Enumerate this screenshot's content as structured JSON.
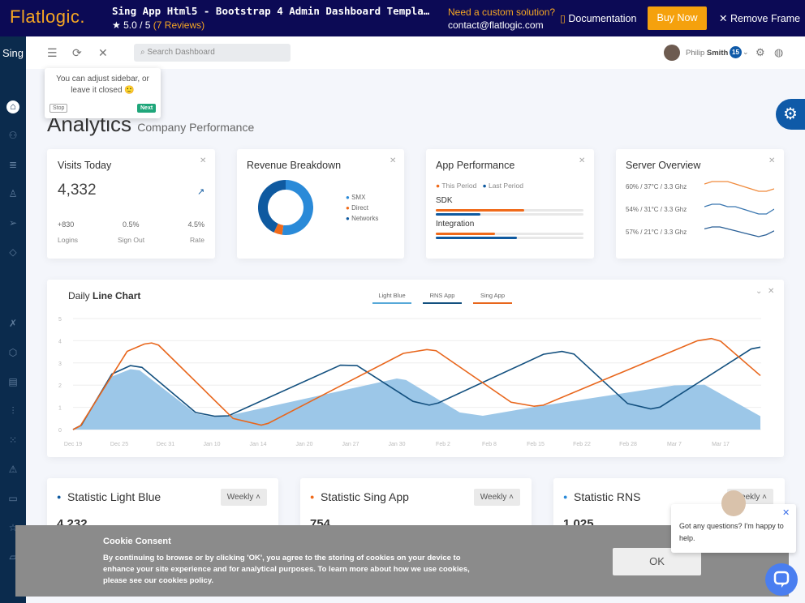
{
  "topbar": {
    "logo": "Flatlogic.",
    "product_title": "Sing App Html5 - Bootstrap 4 Admin Dashboard Templa…",
    "rating": "★ 5.0 / 5",
    "reviews": "(7 Reviews)",
    "need": "Need a custom solution?",
    "contact": "contact@flatlogic.com",
    "documentation": "Documentation",
    "buy": "Buy Now",
    "remove": "Remove Frame"
  },
  "sidebar": {
    "brand": "Sing",
    "icons": [
      "home-icon",
      "users-icon",
      "database-icon",
      "user-icon",
      "send-icon",
      "diamond-icon",
      "tools-icon",
      "package-icon",
      "document-icon",
      "sliders-icon",
      "grid-icon",
      "alert-icon",
      "layers-icon",
      "star-icon",
      "folder-icon"
    ]
  },
  "header": {
    "search_placeholder": "Search Dashboard",
    "user_first": "Philip",
    "user_last": "Smith",
    "badge": "15"
  },
  "tour": {
    "text": "You can adjust sidebar, or leave it closed 🙂",
    "stop": "Stop",
    "next": "Next"
  },
  "page": {
    "title": "Analytics",
    "subtitle": "Company Performance"
  },
  "visits": {
    "title": "Visits Today",
    "value": "4,332",
    "stats": [
      {
        "value": "+830",
        "label": "Logins"
      },
      {
        "value": "0.5%",
        "label": "Sign Out"
      },
      {
        "value": "4.5%",
        "label": "Rate"
      }
    ]
  },
  "revenue": {
    "title": "Revenue Breakdown",
    "slices": [
      {
        "name": "SMX",
        "value": 52,
        "color": "#2a8ad8"
      },
      {
        "name": "Direct",
        "value": 5,
        "color": "#f06a1a"
      },
      {
        "name": "Networks",
        "value": 43,
        "color": "#0f5aa0"
      }
    ]
  },
  "performance": {
    "title": "App Performance",
    "legend": [
      {
        "label": "This Period",
        "color": "#f06a1a"
      },
      {
        "label": "Last Period",
        "color": "#0f5aa0"
      }
    ],
    "rows": [
      {
        "label": "SDK",
        "this": 60,
        "last": 30
      },
      {
        "label": "Integration",
        "this": 40,
        "last": 55
      }
    ]
  },
  "server": {
    "title": "Server Overview",
    "rows": [
      {
        "label": "60% / 37°C / 3.3 Ghz",
        "color": "#f08a3c",
        "values": [
          5,
          6,
          6,
          6,
          5,
          4,
          3,
          2,
          2,
          3
        ]
      },
      {
        "label": "54% / 31°C / 3.3 Ghz",
        "color": "#3b77b0",
        "values": [
          5,
          6,
          6,
          5,
          5,
          4,
          3,
          2,
          2,
          4
        ]
      },
      {
        "label": "57% / 21°C / 3.3 Ghz",
        "color": "#2a5f96",
        "values": [
          5,
          6,
          6,
          5,
          4,
          3,
          2,
          1,
          2,
          4
        ]
      }
    ]
  },
  "chart_data": {
    "type": "line",
    "title_plain": "Daily",
    "title_bold": "Line Chart",
    "ylim": [
      0,
      5
    ],
    "yticks": [
      "0",
      "1",
      "2",
      "3",
      "4",
      "5"
    ],
    "categories": [
      "Dec 19",
      "Dec 25",
      "Dec 31",
      "Jan 10",
      "Jan 14",
      "Jan 20",
      "Jan 27",
      "Jan 30",
      "Feb 2",
      "Feb 8",
      "Feb 15",
      "Feb 22",
      "Feb 28",
      "Mar 7",
      "Mar 17"
    ],
    "grid": true,
    "legend": "top-center",
    "series": [
      {
        "name": "Light Blue",
        "type": "area",
        "color": "#9cc7e8",
        "legend_color": "#56a8d8",
        "points": [
          [
            0,
            0
          ],
          [
            0.18,
            0.2
          ],
          [
            0.84,
            2.39
          ],
          [
            1.24,
            2.72
          ],
          [
            1.44,
            2.67
          ],
          [
            2.65,
            0.72
          ],
          [
            3.06,
            0.56
          ],
          [
            3.41,
            0.65
          ],
          [
            7.0,
            2.3
          ],
          [
            7.2,
            2.23
          ],
          [
            8.36,
            0.77
          ],
          [
            8.86,
            0.62
          ],
          [
            10.07,
            1.05
          ],
          [
            13.0,
            1.99
          ],
          [
            13.65,
            2.02
          ],
          [
            14.86,
            0.6
          ]
        ]
      },
      {
        "name": "RNS App",
        "type": "line",
        "color": "#13507f",
        "points": [
          [
            0,
            0
          ],
          [
            0.18,
            0.2
          ],
          [
            0.84,
            2.5
          ],
          [
            1.24,
            2.88
          ],
          [
            1.49,
            2.8
          ],
          [
            2.65,
            0.77
          ],
          [
            3.06,
            0.6
          ],
          [
            3.36,
            0.62
          ],
          [
            5.78,
            2.9
          ],
          [
            6.14,
            2.88
          ],
          [
            7.35,
            1.27
          ],
          [
            7.7,
            1.1
          ],
          [
            7.9,
            1.2
          ],
          [
            10.17,
            3.39
          ],
          [
            10.57,
            3.52
          ],
          [
            10.83,
            3.4
          ],
          [
            11.99,
            1.17
          ],
          [
            12.49,
            0.93
          ],
          [
            12.69,
            1.01
          ],
          [
            14.66,
            3.63
          ],
          [
            14.86,
            3.71
          ]
        ]
      },
      {
        "name": "Sing App",
        "type": "line",
        "color": "#e8661c",
        "points": [
          [
            0,
            0
          ],
          [
            0.16,
            0.17
          ],
          [
            1.17,
            3.52
          ],
          [
            1.54,
            3.85
          ],
          [
            1.7,
            3.9
          ],
          [
            1.85,
            3.8
          ],
          [
            3.46,
            0.5
          ],
          [
            4.07,
            0.2
          ],
          [
            4.22,
            0.28
          ],
          [
            7.14,
            3.43
          ],
          [
            7.65,
            3.6
          ],
          [
            7.85,
            3.55
          ],
          [
            9.47,
            1.23
          ],
          [
            9.97,
            1.05
          ],
          [
            10.17,
            1.1
          ],
          [
            13.5,
            4.0
          ],
          [
            13.8,
            4.1
          ],
          [
            14.0,
            3.98
          ],
          [
            14.86,
            2.43
          ]
        ]
      }
    ]
  },
  "stats": [
    {
      "title": "Statistic Light Blue",
      "value": "4,232",
      "color": "#0f5aa0",
      "period": "Weekly"
    },
    {
      "title": "Statistic Sing App",
      "value": "754",
      "color": "#f06a1a",
      "period": "Weekly"
    },
    {
      "title": "Statistic RNS",
      "value": "1,025",
      "color": "#2a8ad8",
      "period": "Weekly"
    }
  ],
  "cookie": {
    "title": "Cookie Consent",
    "text": "By continuing to browse or by clicking 'OK', you agree to the storing of cookies on your device to enhance your site experience and for analytical purposes. To learn more about how we use cookies, please see our",
    "link": "cookies policy.",
    "ok": "OK"
  },
  "chat": {
    "text": "Got any questions? I'm happy to help."
  }
}
